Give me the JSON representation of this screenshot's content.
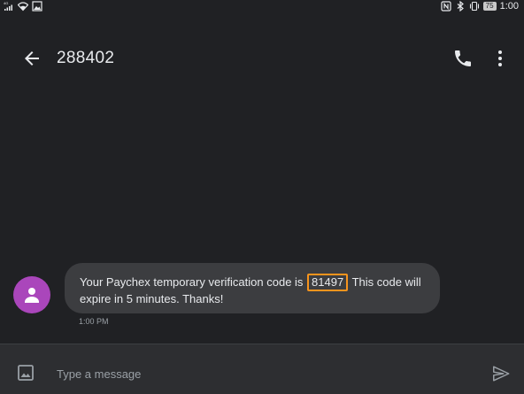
{
  "status_bar": {
    "network_label": "4G",
    "signal_icon": "signal-icon",
    "wifi_icon": "wifi-icon",
    "image_icon": "image-notification-icon",
    "nfc_icon": "nfc-icon",
    "bluetooth_icon": "bluetooth-icon",
    "vibrate_icon": "vibrate-icon",
    "battery_level": "75",
    "time": "1:00"
  },
  "app_bar": {
    "back_icon": "back-arrow-icon",
    "title": "288402",
    "call_icon": "phone-icon",
    "more_icon": "more-vert-icon"
  },
  "conversation": {
    "messages": [
      {
        "avatar_icon": "person-icon",
        "avatar_color": "#aa46bb",
        "text_before": "Your Paychex temporary verification code is",
        "code": "81497",
        "text_after": "This code will expire in 5 minutes.  Thanks!",
        "timestamp": "1:00 PM",
        "code_highlight_color": "#f7941d"
      }
    ]
  },
  "compose": {
    "attach_icon": "image-attach-icon",
    "placeholder": "Type a message",
    "value": "",
    "send_icon": "send-icon"
  },
  "colors": {
    "background": "#202124",
    "bubble": "#3c3d40",
    "compose_bar": "#2d2e31"
  }
}
